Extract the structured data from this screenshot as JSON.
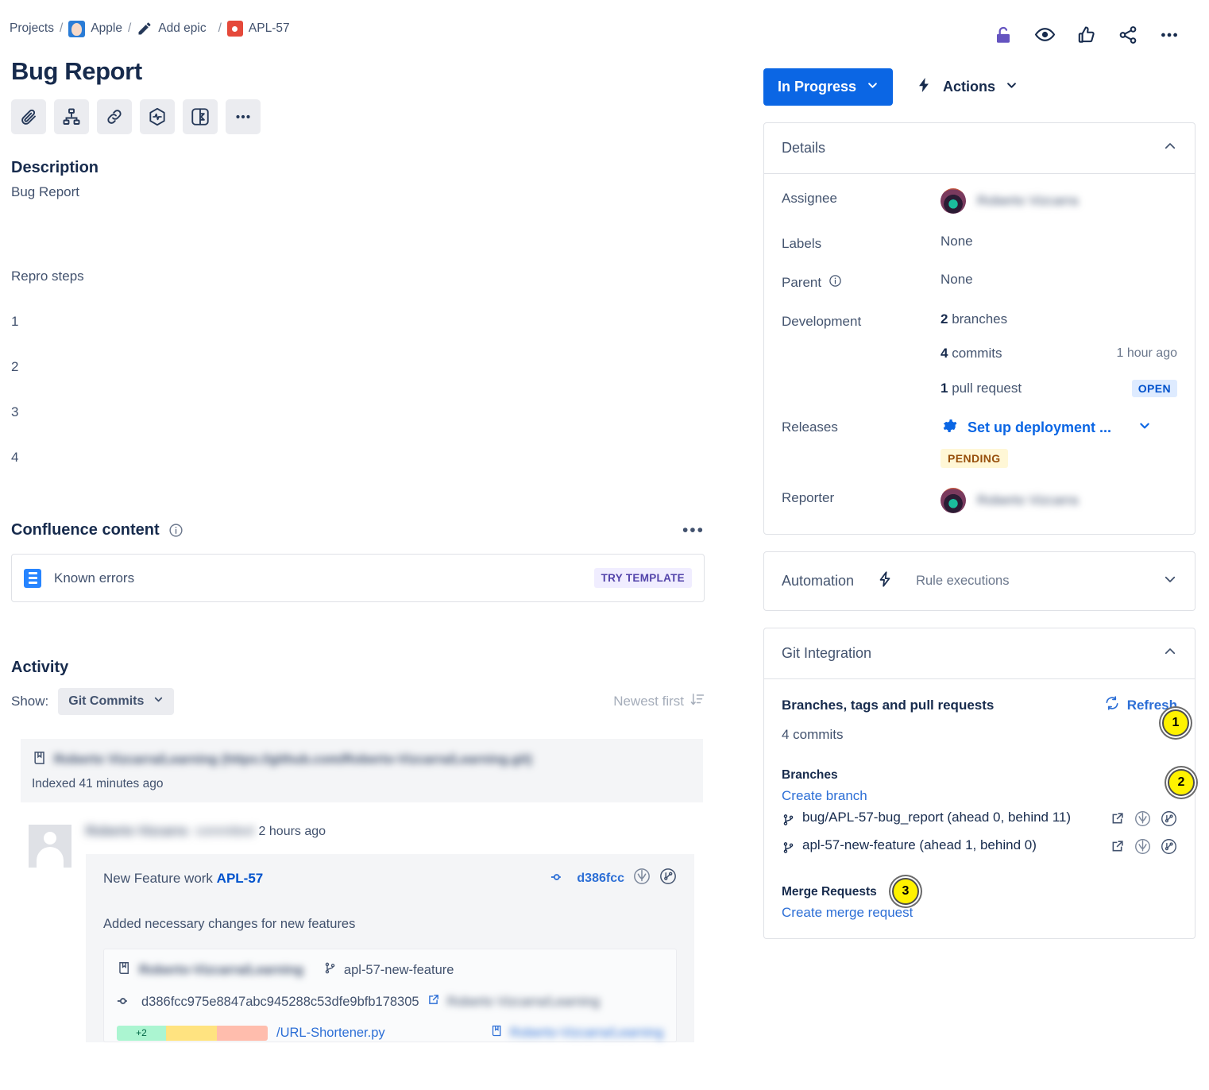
{
  "breadcrumb": {
    "projects": "Projects",
    "project": "Apple",
    "epic": "Add epic",
    "issue_key": "APL-57",
    "sep": "/"
  },
  "issue": {
    "title": "Bug Report"
  },
  "action_bar": {
    "icons": [
      "attach-icon",
      "child-issue-icon",
      "link-icon",
      "app-insights-icon",
      "app-panel-icon",
      "more-icon"
    ],
    "more_label": "•••"
  },
  "description": {
    "heading": "Description",
    "body": "Bug Report",
    "repro_heading": "Repro steps",
    "repro_items": [
      "1",
      "2",
      "3",
      "4"
    ]
  },
  "confluence": {
    "heading": "Confluence content",
    "more_label": "•••",
    "item_name": "Known errors",
    "try_template": "TRY TEMPLATE"
  },
  "activity": {
    "heading": "Activity",
    "show_label": "Show:",
    "show_value": "Git Commits",
    "sort_label": "Newest first",
    "repo": {
      "name_redacted": "Roberto Vizcarra/Learning (https://github.com/Roberto-Vizcarra/Learning.git)",
      "indexed": "Indexed 41 minutes ago"
    },
    "comment": {
      "author_redacted": "Roberto Vizcarra",
      "action_redacted": "committed",
      "time": "2 hours ago",
      "commit_title_prefix": "New Feature work ",
      "commit_title_key": "APL-57",
      "commit_short_hash": "d386fcc",
      "commit_description": "Added necessary changes for new features",
      "inner_repo_redacted": "Roberto-Vizcarra/Learning",
      "inner_branch": "apl-57-new-feature",
      "full_hash": "d386fcc975e8847abc945288c53dfe9bfb178305",
      "author_tag_redacted": "Roberto Vizcarra/Learning",
      "diff_added": "+2",
      "file_path": "/URL-Shortener.py",
      "file_author_redacted": "Roberto-Vizcarra/Learning"
    }
  },
  "right": {
    "top_icons": [
      "unlock-icon",
      "watch-eye-icon",
      "thumbs-up-icon",
      "share-icon",
      "more-icon"
    ],
    "status_button": "In Progress",
    "actions_button": "Actions",
    "details": {
      "heading": "Details",
      "fields": [
        {
          "label": "Assignee",
          "value_redacted": "Roberto Vizcarra",
          "type": "user"
        },
        {
          "label": "Labels",
          "value": "None",
          "type": "text"
        },
        {
          "label": "Parent",
          "value": "None",
          "type": "text",
          "has_info": true
        },
        {
          "label": "Development",
          "type": "development"
        },
        {
          "label": "Releases",
          "type": "releases"
        },
        {
          "label": "Reporter",
          "value_redacted": "Roberto Vizcarra",
          "type": "user"
        }
      ],
      "development": {
        "branches": "2 branches",
        "branches_count": "2",
        "commits": "4 commits",
        "commits_count": "4",
        "commits_time": "1 hour ago",
        "pull_request": "1 pull request",
        "pull_request_count": "1",
        "pull_request_status": "OPEN"
      },
      "releases": {
        "link": "Set up deployment ...",
        "status": "PENDING"
      }
    },
    "automation": {
      "heading": "Automation",
      "rule_label": "Rule executions"
    },
    "git_integration": {
      "heading": "Git Integration",
      "section_title": "Branches, tags and pull requests",
      "refresh_label": "Refresh",
      "commits_count": "4 commits",
      "branches_heading": "Branches",
      "create_branch": "Create branch",
      "branches": [
        "bug/APL-57-bug_report (ahead 0, behind 11)",
        "apl-57-new-feature (ahead 1, behind 0)"
      ],
      "merge_heading": "Merge Requests",
      "create_merge_request": "Create merge request"
    }
  },
  "annotations": [
    {
      "number": "1",
      "target": "git-integration-collapse-chevron"
    },
    {
      "number": "2",
      "target": "git-refresh-button"
    },
    {
      "number": "3",
      "target": "create-branch-link"
    }
  ],
  "colors": {
    "primary_blue": "#0B66E4",
    "link_blue": "#2D6FD6",
    "text": "#172B4D",
    "muted": "#44546F",
    "badge_open_bg": "#DEEBFF",
    "badge_pending_bg": "#FFF7D6",
    "try_template_bg": "#F0EDFF",
    "annotation_yellow": "#FFF200"
  }
}
